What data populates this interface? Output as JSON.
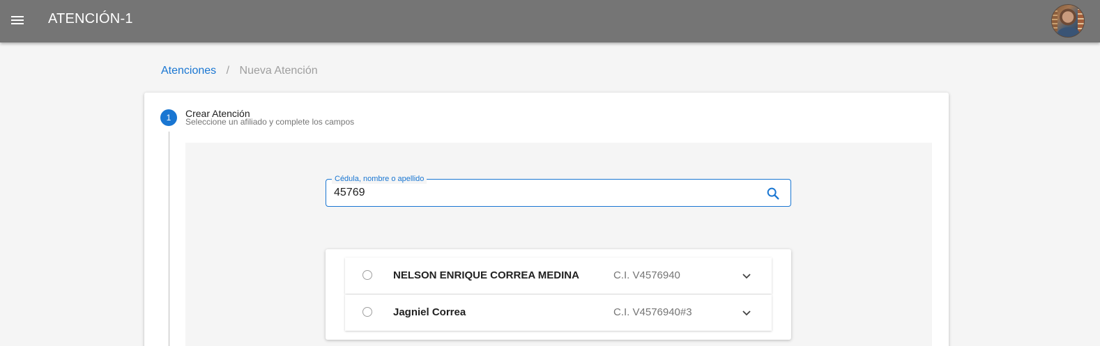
{
  "appbar": {
    "title": "ATENCIÓN-1",
    "menu_icon": "hamburger-menu-icon",
    "avatar_icon": "user-avatar"
  },
  "breadcrumb": {
    "link": "Atenciones",
    "separator": "/",
    "current": "Nueva Atención"
  },
  "stepper": {
    "step_number": "1",
    "title": "Crear Atención",
    "subtitle": "Seleccione un afiliado y complete los campos"
  },
  "search": {
    "label": "Cédula, nombre o apellido",
    "value": "45769",
    "icon": "search-icon"
  },
  "results": [
    {
      "name": "NELSON ENRIQUE CORREA MEDINA",
      "ci": "C.I. V4576940"
    },
    {
      "name": "Jagniel Correa",
      "ci": "C.I. V4576940#3"
    }
  ],
  "colors": {
    "appbar": "#757575",
    "accent": "#1976d2",
    "background": "#f5f5f5"
  }
}
